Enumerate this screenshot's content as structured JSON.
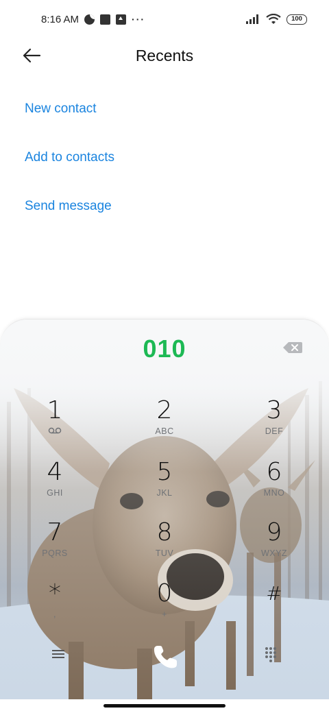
{
  "status_bar": {
    "time": "8:16 AM",
    "icons": [
      "data-saver-icon",
      "square-notification-icon",
      "upload-notification-icon",
      "more-dots-icon",
      "signal-icon",
      "wifi-icon",
      "battery-icon"
    ],
    "more": "···",
    "battery": "100"
  },
  "header": {
    "title": "Recents",
    "back_icon": "back-arrow-icon"
  },
  "options": {
    "new_contact": "New contact",
    "add_to_contacts": "Add to contacts",
    "send_message": "Send message"
  },
  "colors": {
    "link": "#1a84df",
    "number": "#1db954"
  },
  "dialer": {
    "number": "010",
    "keys": [
      {
        "digit": "1",
        "letters": "voicemail-icon"
      },
      {
        "digit": "2",
        "letters": "ABC"
      },
      {
        "digit": "3",
        "letters": "DEF"
      },
      {
        "digit": "4",
        "letters": "GHI"
      },
      {
        "digit": "5",
        "letters": "JKL"
      },
      {
        "digit": "6",
        "letters": "MNO"
      },
      {
        "digit": "7",
        "letters": "PQRS"
      },
      {
        "digit": "8",
        "letters": "TUV"
      },
      {
        "digit": "9",
        "letters": "WXYZ"
      },
      {
        "digit": "*",
        "letters": ","
      },
      {
        "digit": "0",
        "letters": "+"
      },
      {
        "digit": "#",
        "letters": ""
      }
    ],
    "bottom_icons": [
      "menu-icon",
      "phone-call-icon",
      "dialpad-icon"
    ]
  }
}
